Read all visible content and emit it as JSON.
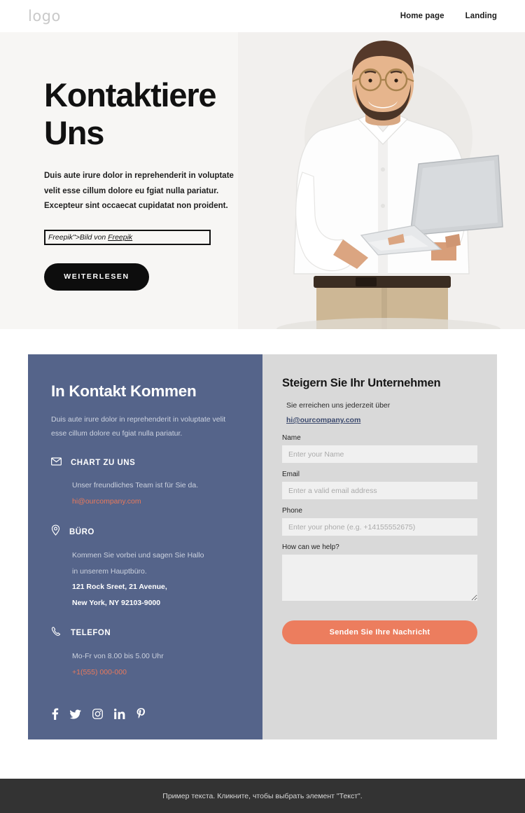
{
  "header": {
    "logo": "logo",
    "nav": [
      {
        "label": "Home page"
      },
      {
        "label": "Landing"
      }
    ]
  },
  "hero": {
    "title": "Kontaktiere Uns",
    "paragraph_lines": [
      "Duis aute irure dolor in reprehenderit in voluptate",
      "velit esse cillum dolore eu fgiat nulla pariatur.",
      "Excepteur sint occaecat cupidatat non proident."
    ],
    "credit_prefix": "Freepik\">Bild von ",
    "credit_link": "Freepik",
    "cta_label": "WEITERLESEN",
    "image_alt": "smiling-bearded-man-with-glasses-holding-laptop",
    "background_color": "#f7f6f4"
  },
  "contact": {
    "left": {
      "heading": "In Kontakt Kommen",
      "intro_lines": [
        "Duis aute irure dolor in reprehenderit in voluptate velit",
        "esse cillum dolore eu fgiat nulla pariatur."
      ],
      "background_color": "#55648a",
      "blocks": [
        {
          "icon": "envelope-icon",
          "title": "CHART ZU UNS",
          "lines": [
            "Unser freundliches Team ist für Sie da."
          ],
          "highlight": "hi@ourcompany.com"
        },
        {
          "icon": "location-pin-icon",
          "title": "BÜRO",
          "lines": [
            "Kommen Sie vorbei und sagen Sie Hallo",
            "in unserem Hauptbüro."
          ],
          "strong_lines": [
            "121 Rock Sreet, 21 Avenue,",
            "New York, NY 92103-9000"
          ],
          "highlight": ""
        },
        {
          "icon": "phone-icon",
          "title": "TELEFON",
          "lines": [
            "Mo-Fr von 8.00 bis 5.00 Uhr"
          ],
          "highlight": "+1(555) 000-000"
        }
      ],
      "socials": [
        {
          "name": "facebook-icon"
        },
        {
          "name": "twitter-icon"
        },
        {
          "name": "instagram-icon"
        },
        {
          "name": "linkedin-icon"
        },
        {
          "name": "pinterest-icon"
        }
      ],
      "accent_color": "#e8795c"
    },
    "right": {
      "heading": "Steigern Sie Ihr Unternehmen",
      "reach_text": "Sie erreichen uns jederzeit über",
      "reach_link": "hi@ourcompany.com",
      "background_color": "#d9d9d9",
      "fields": [
        {
          "label": "Name",
          "placeholder": "Enter your Name",
          "value": "",
          "type": "text"
        },
        {
          "label": "Email",
          "placeholder": "Enter a valid email address",
          "value": "",
          "type": "text"
        },
        {
          "label": "Phone",
          "placeholder": "Enter your phone (e.g. +14155552675)",
          "value": "",
          "type": "text"
        },
        {
          "label": "How can we help?",
          "placeholder": "",
          "value": "",
          "type": "textarea"
        }
      ],
      "submit_label": "Senden Sie Ihre Nachricht",
      "submit_color": "#ec7d5e"
    }
  },
  "footer": {
    "text": "Пример текста. Кликните, чтобы выбрать элемент \"Текст\".",
    "background_color": "#333333"
  }
}
